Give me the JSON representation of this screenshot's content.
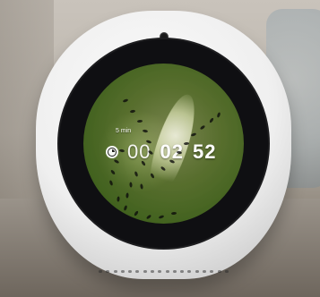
{
  "timer": {
    "label": "5 min",
    "hours": "00",
    "minutes": "02",
    "seconds": "52"
  },
  "icons": {
    "timer": "timer-icon",
    "camera": "camera-dot-icon"
  },
  "colors": {
    "device_white": "#efefef",
    "bezel_black": "#0f0f12",
    "screen_green": "#8fbf3f"
  }
}
